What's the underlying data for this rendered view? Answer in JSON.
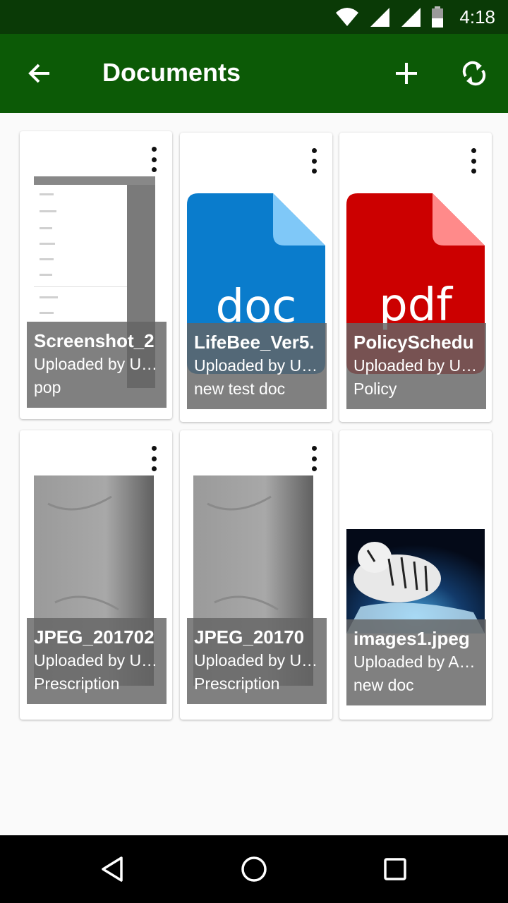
{
  "status_bar": {
    "time": "4:18"
  },
  "app_bar": {
    "title": "Documents"
  },
  "documents": [
    {
      "name": "Screenshot_2",
      "uploaded_by": "Uploaded by U…",
      "tag": "pop"
    },
    {
      "name": "LifeBee_Ver5.",
      "uploaded_by": "Uploaded by U…",
      "tag": "new test doc",
      "file_label": "doc"
    },
    {
      "name": "PolicySchedu",
      "uploaded_by": "Uploaded by U…",
      "tag": "Policy",
      "file_label": "pdf"
    },
    {
      "name": "JPEG_201702",
      "uploaded_by": "Uploaded by U…",
      "tag": "Prescription"
    },
    {
      "name": "JPEG_20170",
      "uploaded_by": "Uploaded by U…",
      "tag": "Prescription"
    },
    {
      "name": "images1.jpeg",
      "uploaded_by": "Uploaded by A…",
      "tag": "new doc"
    }
  ],
  "colors": {
    "status_bar": "#0a3a06",
    "app_bar": "#0c5a06",
    "doc_icon": "#0a7ccc",
    "pdf_icon": "#cc0000"
  }
}
